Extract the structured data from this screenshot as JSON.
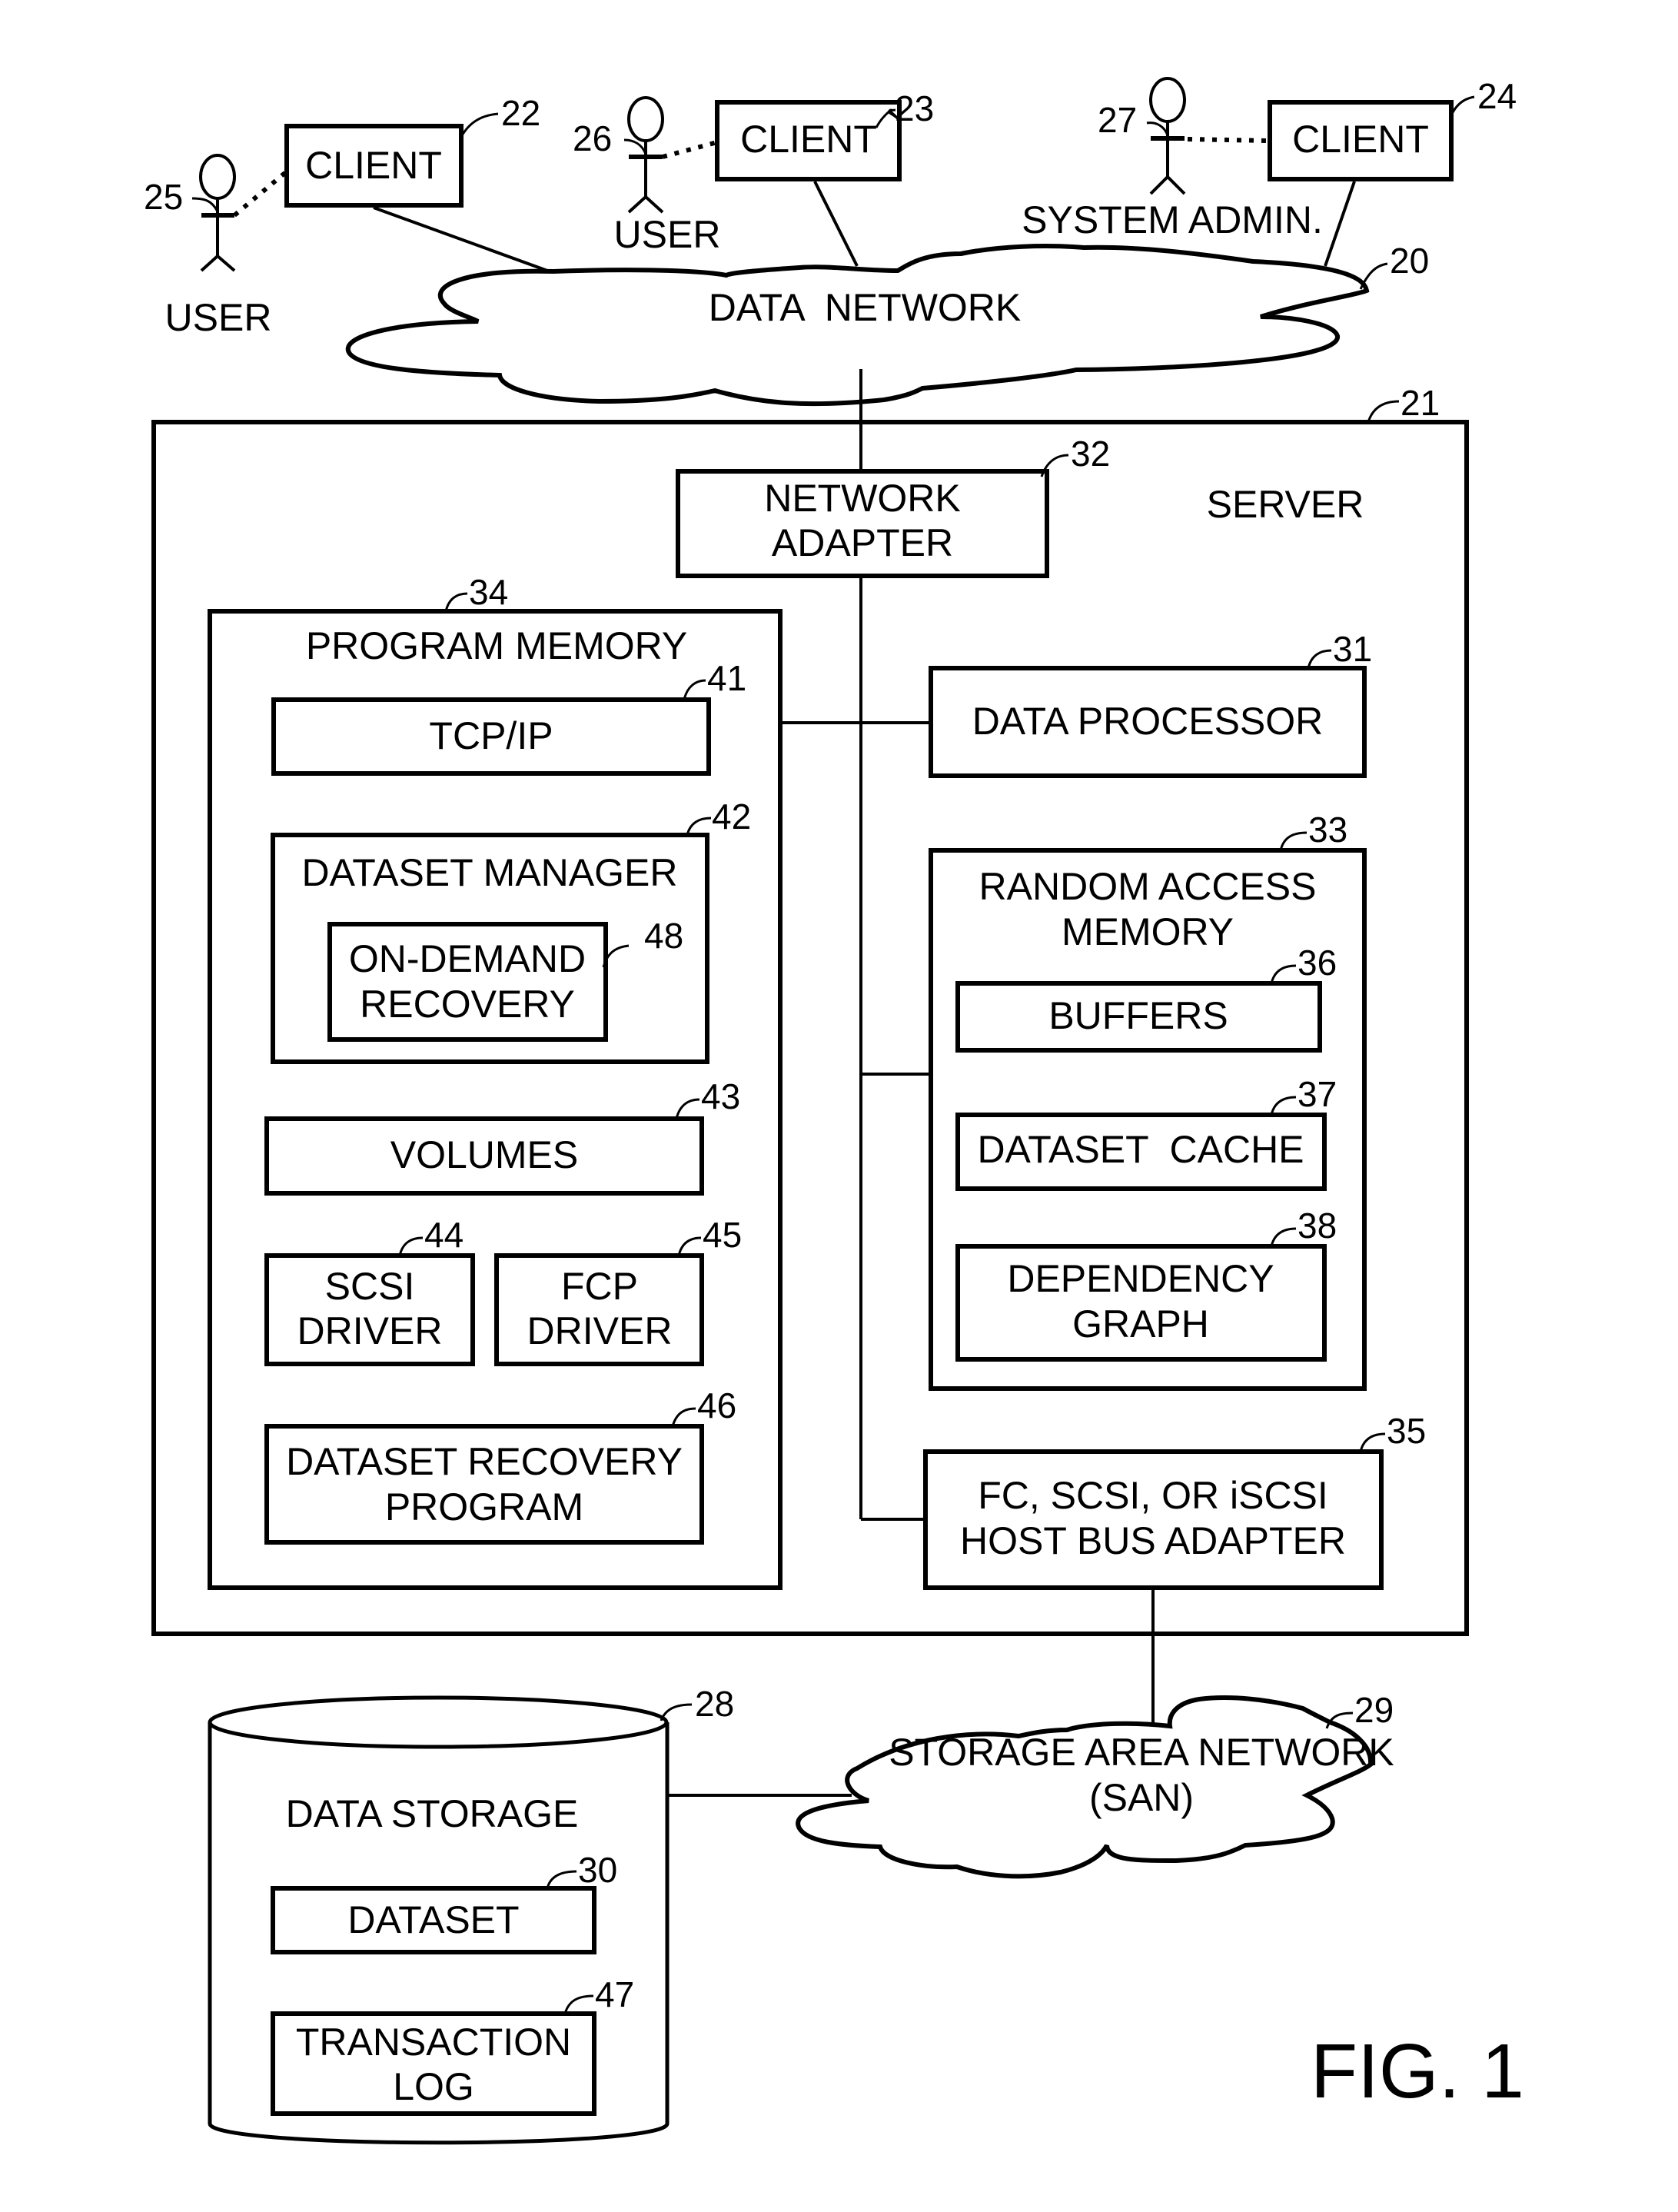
{
  "figure": {
    "title": "FIG. 1"
  },
  "actors": [
    {
      "id": "user-25",
      "label": "USER",
      "ref": "25"
    },
    {
      "id": "user-26",
      "label": "USER",
      "ref": "26"
    },
    {
      "id": "sysadmin-27",
      "label": "SYSTEM ADMIN.",
      "ref": "27"
    }
  ],
  "clients": [
    {
      "label": "CLIENT",
      "ref": "22"
    },
    {
      "label": "CLIENT",
      "ref": "23"
    },
    {
      "label": "CLIENT",
      "ref": "24"
    }
  ],
  "data_network": {
    "label": "DATA  NETWORK",
    "ref": "20"
  },
  "server": {
    "label": "SERVER",
    "ref": "21",
    "network_adapter": {
      "lines": [
        "NETWORK",
        "ADAPTER"
      ],
      "ref": "32"
    },
    "program_memory": {
      "label": "PROGRAM MEMORY",
      "ref": "34",
      "tcpip": {
        "label": "TCP/IP",
        "ref": "41"
      },
      "dataset_manager": {
        "label": "DATASET MANAGER",
        "ref": "42",
        "on_demand_recovery": {
          "lines": [
            "ON-DEMAND",
            "RECOVERY"
          ],
          "ref": "48"
        }
      },
      "volumes": {
        "label": "VOLUMES",
        "ref": "43"
      },
      "scsi_driver": {
        "lines": [
          "SCSI",
          "DRIVER"
        ],
        "ref": "44"
      },
      "fcp_driver": {
        "lines": [
          "FCP",
          "DRIVER"
        ],
        "ref": "45"
      },
      "dataset_recovery_program": {
        "lines": [
          "DATASET RECOVERY",
          "PROGRAM"
        ],
        "ref": "46"
      }
    },
    "data_processor": {
      "label": "DATA PROCESSOR",
      "ref": "31"
    },
    "ram": {
      "lines": [
        "RANDOM ACCESS",
        "MEMORY"
      ],
      "ref": "33",
      "buffers": {
        "label": "BUFFERS",
        "ref": "36"
      },
      "dataset_cache": {
        "label": "DATASET  CACHE",
        "ref": "37"
      },
      "dependency_graph": {
        "lines": [
          "DEPENDENCY",
          "GRAPH"
        ],
        "ref": "38"
      }
    },
    "host_bus_adapter": {
      "lines": [
        "FC, SCSI, OR iSCSI",
        "HOST BUS ADAPTER"
      ],
      "ref": "35"
    }
  },
  "san": {
    "lines": [
      "STORAGE AREA NETWORK",
      "(SAN)"
    ],
    "ref": "29"
  },
  "data_storage": {
    "label": "DATA STORAGE",
    "ref": "28",
    "dataset": {
      "label": "DATASET",
      "ref": "30"
    },
    "transaction_log": {
      "lines": [
        "TRANSACTION",
        "LOG"
      ],
      "ref": "47"
    }
  }
}
